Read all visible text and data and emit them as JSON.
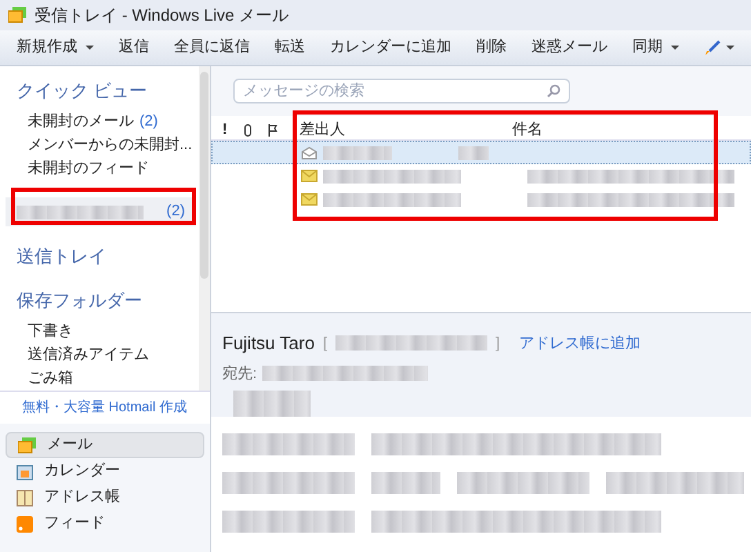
{
  "window": {
    "title": "受信トレイ - Windows Live メール"
  },
  "toolbar": [
    {
      "label": "新規作成",
      "kind": "dropdown"
    },
    {
      "label": "返信",
      "kind": "button"
    },
    {
      "label": "全員に返信",
      "kind": "button"
    },
    {
      "label": "転送",
      "kind": "button"
    },
    {
      "label": "カレンダーに追加",
      "kind": "button"
    },
    {
      "label": "削除",
      "kind": "button"
    },
    {
      "label": "迷惑メール",
      "kind": "button"
    },
    {
      "label": "同期",
      "kind": "dropdown"
    }
  ],
  "sidebar": {
    "quick_view": {
      "title": "クイック ビュー",
      "items": [
        {
          "label": "未開封のメール",
          "count": "(2)"
        },
        {
          "label": "メンバーからの未開封..."
        },
        {
          "label": "未開封のフィード"
        }
      ]
    },
    "account": {
      "count": "(2)",
      "selected": true,
      "highlighted": true
    },
    "outbox": "送信トレイ",
    "storage": {
      "title": "保存フォルダー",
      "items": [
        {
          "label": "下書き"
        },
        {
          "label": "送信済みアイテム"
        },
        {
          "label": "ごみ箱"
        }
      ]
    },
    "hotmail_link": "無料・大容量 Hotmail 作成",
    "nav": [
      {
        "label": "メール",
        "selected": true
      },
      {
        "label": "カレンダー",
        "selected": false
      },
      {
        "label": "アドレス帳",
        "selected": false
      },
      {
        "label": "フィード",
        "selected": false
      }
    ]
  },
  "search": {
    "placeholder": "メッセージの検索"
  },
  "message_list": {
    "columns": [
      "!",
      "差出人",
      "件名"
    ],
    "highlighted": true,
    "rows": [
      {
        "selected": true,
        "read": true
      },
      {
        "selected": false,
        "read": false
      },
      {
        "selected": false,
        "read": false
      }
    ]
  },
  "preview": {
    "sender": "Fujitsu Taro",
    "bracket_open": "[",
    "bracket_close": "]",
    "add_link": "アドレス帳に追加",
    "to_label": "宛先:"
  }
}
